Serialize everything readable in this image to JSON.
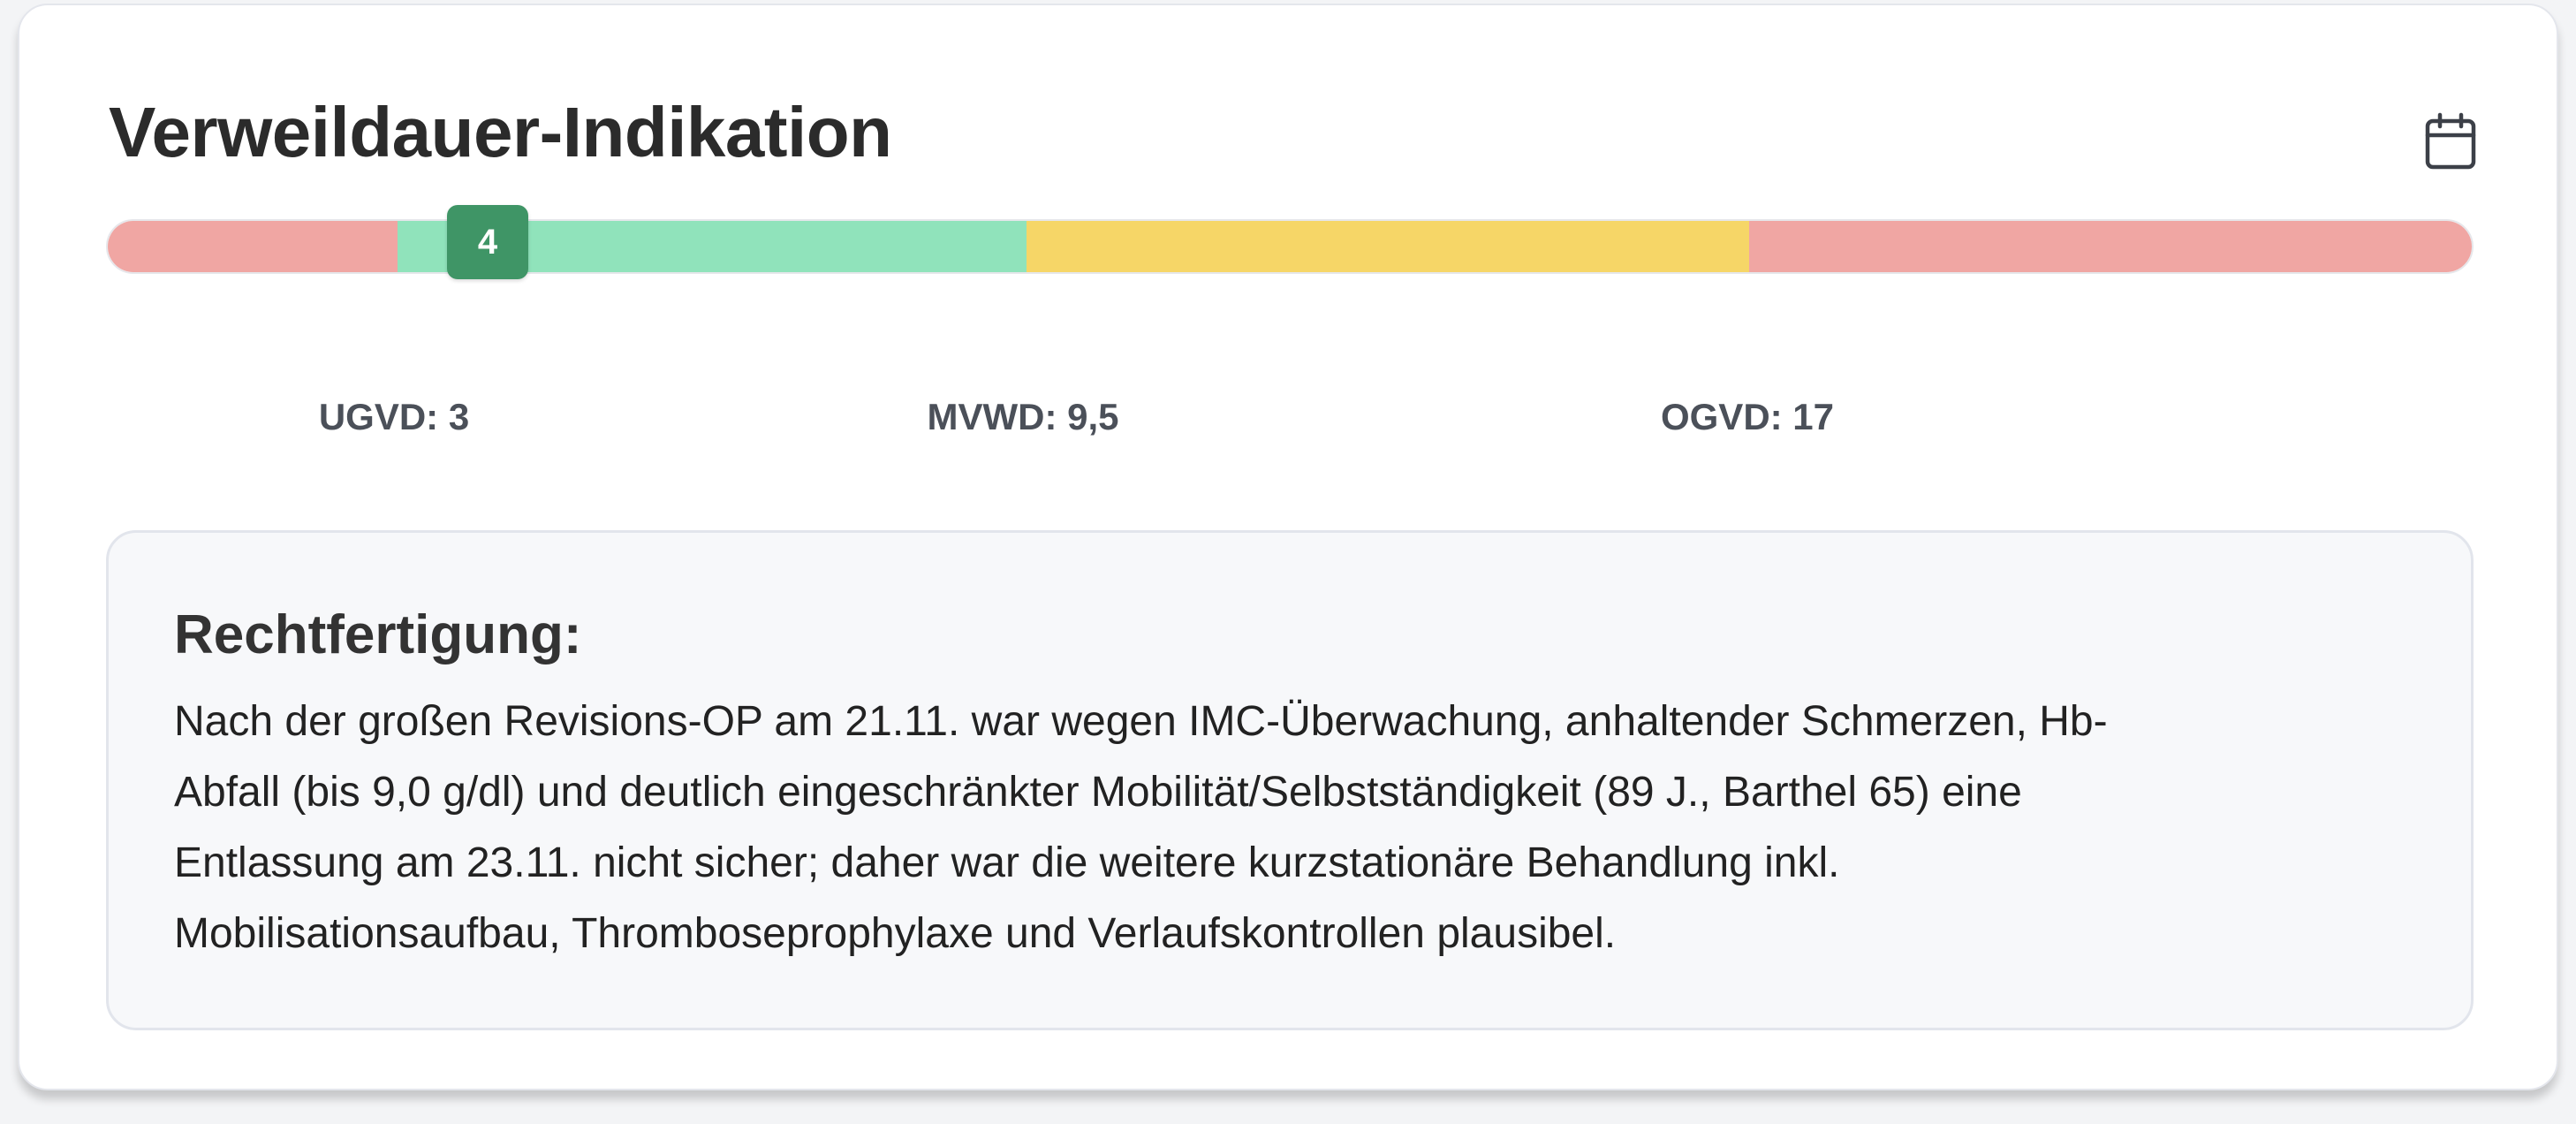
{
  "card": {
    "title": "Verweildauer-Indikation",
    "calendar_icon": "calendar-icon"
  },
  "scale": {
    "marker_value": "4",
    "segments": [
      {
        "name": "below-ugvd",
        "color": "#f0a6a3"
      },
      {
        "name": "ugvd-to-mvwd",
        "color": "#90e3bb"
      },
      {
        "name": "mvwd-to-ogvd",
        "color": "#f6d667"
      },
      {
        "name": "above-ogvd",
        "color": "#f0a6a3"
      }
    ],
    "marker_color": "#3f9566",
    "labels": {
      "ugvd": "UGVD: 3",
      "mvwd": "MVWD: 9,5",
      "ogvd": "OGVD: 17"
    }
  },
  "justification": {
    "heading": "Rechtfertigung:",
    "lines": [
      "Nach der großen Revisions-OP am 21.11. war wegen IMC-Überwachung, anhaltender Schmerzen, Hb-",
      "Abfall (bis 9,0 g/dl) und deutlich eingeschränkter Mobilität/Selbstständigkeit (89 J., Barthel 65) eine",
      "Entlassung am 23.11. nicht sicher; daher war die weitere kurzstationäre Behandlung inkl.",
      "Mobilisationsaufbau, Thromboseprophylaxe und Verlaufskontrollen plausibel."
    ]
  }
}
